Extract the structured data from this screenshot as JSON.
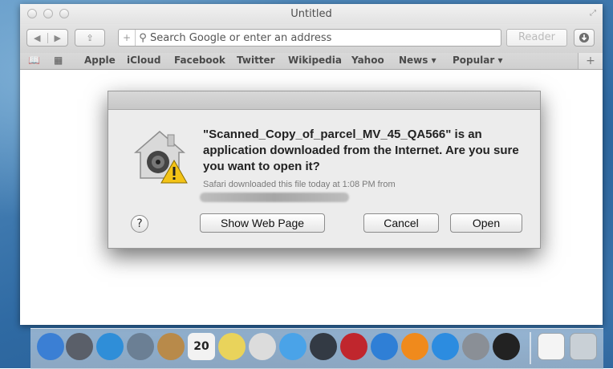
{
  "window": {
    "title": "Untitled",
    "address_placeholder": "Search Google or enter an address",
    "reader_label": "Reader"
  },
  "bookmarks": [
    {
      "label": "Apple"
    },
    {
      "label": "iCloud"
    },
    {
      "label": "Facebook"
    },
    {
      "label": "Twitter"
    },
    {
      "label": "Wikipedia"
    },
    {
      "label": "Yahoo"
    },
    {
      "label": "News ▾"
    },
    {
      "label": "Popular ▾"
    }
  ],
  "dialog": {
    "message": "\"Scanned_Copy_of_parcel_MV_45_QA566\" is an application downloaded from the Internet. Are you sure you want to open it?",
    "info": "Safari downloaded this file today at 1:08 PM from",
    "help_label": "?",
    "show_web_page_label": "Show Web Page",
    "cancel_label": "Cancel",
    "open_label": "Open"
  },
  "dock": {
    "items": [
      {
        "name": "finder-icon",
        "color": "#3b7fd4"
      },
      {
        "name": "launchpad-icon",
        "color": "#5a5f69"
      },
      {
        "name": "safari-icon",
        "color": "#2f8ed8"
      },
      {
        "name": "mail-icon",
        "color": "#6b7f94"
      },
      {
        "name": "contacts-icon",
        "color": "#b88a4a"
      },
      {
        "name": "calendar-icon",
        "color": "#f2f2f2"
      },
      {
        "name": "notes-icon",
        "color": "#e9d35b"
      },
      {
        "name": "reminders-icon",
        "color": "#dcdcdc"
      },
      {
        "name": "messages-icon",
        "color": "#4aa3e8"
      },
      {
        "name": "facetime-icon",
        "color": "#333a44"
      },
      {
        "name": "photo-booth-icon",
        "color": "#c0262d"
      },
      {
        "name": "itunes-icon",
        "color": "#2f7fd6"
      },
      {
        "name": "ibooks-icon",
        "color": "#f08a1c"
      },
      {
        "name": "app-store-icon",
        "color": "#2c8ce0"
      },
      {
        "name": "system-preferences-icon",
        "color": "#8a8f96"
      },
      {
        "name": "terminal-icon",
        "color": "#222222"
      },
      {
        "name": "pdf-document-icon",
        "color": "#f4f4f4"
      },
      {
        "name": "trash-icon",
        "color": "#c9d0d6"
      }
    ],
    "calendar_day": "20"
  }
}
